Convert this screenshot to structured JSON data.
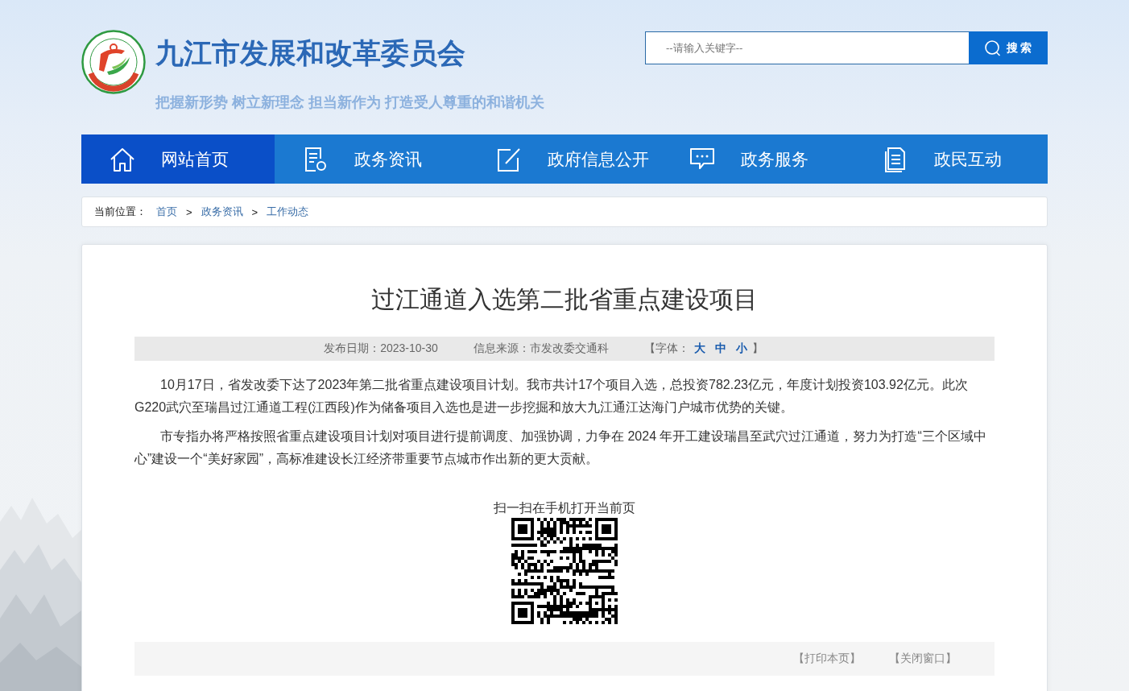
{
  "header": {
    "site_title": "九江市发展和改革委员会",
    "slogan": "把握新形势 树立新理念 担当新作为 打造受人尊重的和谐机关"
  },
  "search": {
    "placeholder": "--请输入关键字--",
    "button": "搜 索"
  },
  "nav": [
    {
      "label": "网站首页",
      "selected": true
    },
    {
      "label": "政务资讯",
      "selected": false
    },
    {
      "label": "政府信息公开",
      "selected": false
    },
    {
      "label": "政务服务",
      "selected": false
    },
    {
      "label": "政民互动",
      "selected": false
    }
  ],
  "breadcrumb": {
    "label": "当前位置：",
    "separator": ">",
    "items": [
      "首页",
      "政务资讯",
      "工作动态"
    ]
  },
  "article": {
    "title": "过江通道入选第二批省重点建设项目",
    "date": "发布日期：2023-10-30",
    "source": "信息来源：市发改委交通科",
    "font_size": {
      "label": "【字体：",
      "options": [
        "大",
        "中",
        "小"
      ],
      "close": "】"
    },
    "paragraphs": [
      "10月17日，省发改委下达了2023年第二批省重点建设项目计划。我市共计17个项目入选，总投资782.23亿元，年度计划投资103.92亿元。此次G220武穴至瑞昌过江通道工程(江西段)作为储备项目入选也是进一步挖掘和放大九江通江达海门户城市优势的关键。",
      "市专指办将严格按照省重点建设项目计划对项目进行提前调度、加强协调，力争在 2024 年开工建设瑞昌至武穴过江通道，努力为打造“三个区域中心”建设一个“美好家园”，高标准建设长江经济带重要节点城市作出新的更大贡献。"
    ],
    "qr_caption": "扫一扫在手机打开当前页",
    "actions": [
      "【打印本页】",
      "【关闭窗口】"
    ]
  }
}
